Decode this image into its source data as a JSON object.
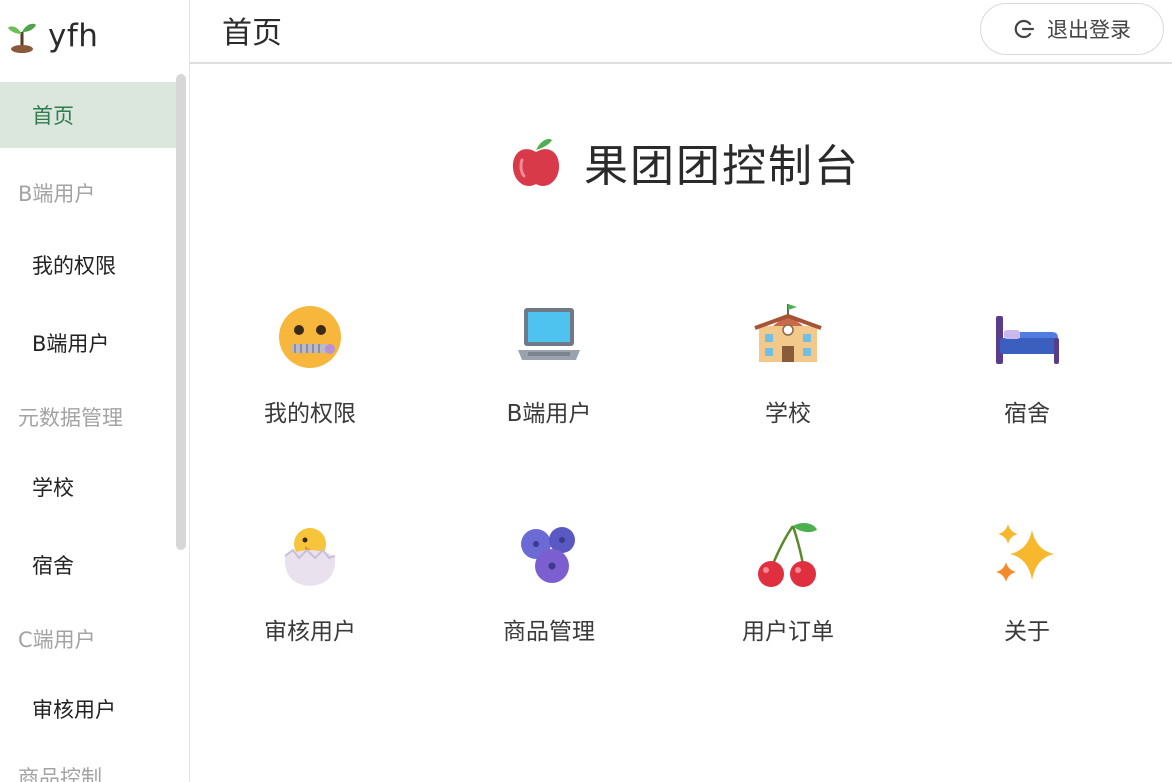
{
  "app": {
    "name": "yfh"
  },
  "sidebar": {
    "items": [
      {
        "label": "首页",
        "active": true
      },
      {
        "label": "我的权限"
      },
      {
        "label": "B端用户"
      },
      {
        "label": "学校"
      },
      {
        "label": "宿舍"
      },
      {
        "label": "审核用户"
      }
    ],
    "groups": [
      {
        "label": "B端用户"
      },
      {
        "label": "元数据管理"
      },
      {
        "label": "C端用户"
      },
      {
        "label": "商品控制"
      }
    ]
  },
  "header": {
    "title": "首页",
    "logout_label": "退出登录",
    "logout_icon": "logout-icon"
  },
  "main": {
    "brand_title": "果团团控制台",
    "brand_icon": "apple-icon",
    "tiles": [
      {
        "label": "我的权限",
        "icon": "zipper-mouth-face-icon"
      },
      {
        "label": "B端用户",
        "icon": "laptop-icon"
      },
      {
        "label": "学校",
        "icon": "school-icon"
      },
      {
        "label": "宿舍",
        "icon": "bed-icon"
      },
      {
        "label": "审核用户",
        "icon": "hatching-chick-icon"
      },
      {
        "label": "商品管理",
        "icon": "blueberries-icon"
      },
      {
        "label": "用户订单",
        "icon": "cherries-icon"
      },
      {
        "label": "关于",
        "icon": "sparkles-icon"
      }
    ]
  },
  "colors": {
    "active_bg": "#dbe6dd",
    "active_accent": "#3a8f5c",
    "group_text": "#a3a3a3"
  }
}
